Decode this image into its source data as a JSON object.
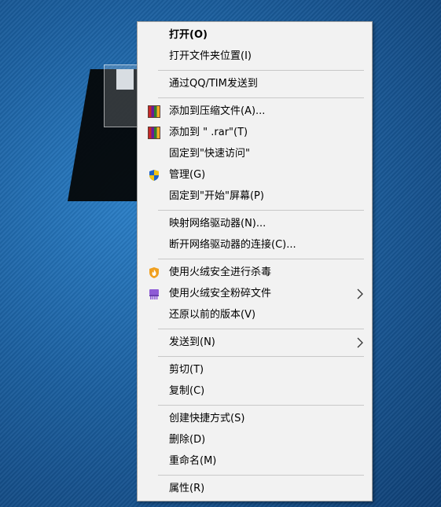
{
  "menu": {
    "items": [
      {
        "label": "打开(O)",
        "bold": true
      },
      {
        "label": "打开文件夹位置(I)"
      },
      {
        "label": "通过QQ/TIM发送到"
      },
      {
        "label": "添加到压缩文件(A)...",
        "icon": "winrar-icon"
      },
      {
        "label": "添加到 \"  .rar\"(T)",
        "icon": "winrar-icon"
      },
      {
        "label": "固定到\"快速访问\""
      },
      {
        "label": "管理(G)",
        "icon": "uac-shield-icon"
      },
      {
        "label": "固定到\"开始\"屏幕(P)"
      },
      {
        "label": "映射网络驱动器(N)..."
      },
      {
        "label": "断开网络驱动器的连接(C)..."
      },
      {
        "label": "使用火绒安全进行杀毒",
        "icon": "huorong-shield-icon"
      },
      {
        "label": "使用火绒安全粉碎文件",
        "icon": "shredder-icon",
        "submenu": true
      },
      {
        "label": "还原以前的版本(V)"
      },
      {
        "label": "发送到(N)",
        "submenu": true
      },
      {
        "label": "剪切(T)"
      },
      {
        "label": "复制(C)"
      },
      {
        "label": "创建快捷方式(S)"
      },
      {
        "label": "删除(D)"
      },
      {
        "label": "重命名(M)"
      },
      {
        "label": "属性(R)"
      }
    ]
  },
  "colors": {
    "menu_bg": "#f2f2f2",
    "separator": "#c8c8c8",
    "desktop": "#1b5f9f"
  }
}
